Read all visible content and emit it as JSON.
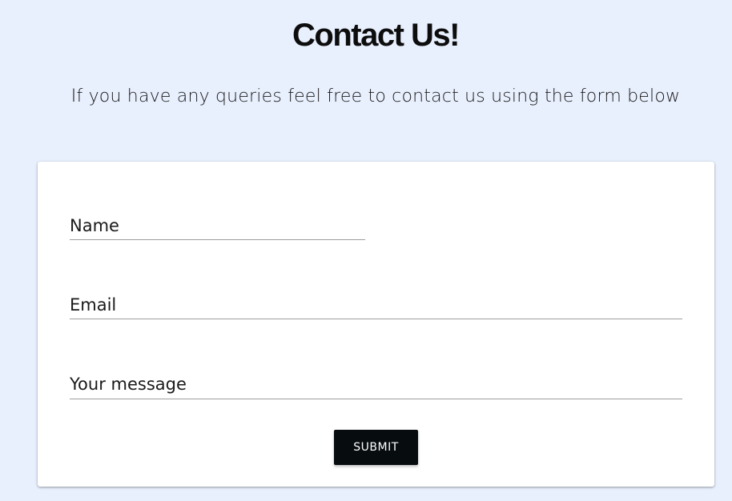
{
  "page": {
    "title": "Contact Us!",
    "subtitle": "If you have any queries feel free to contact us using the form below"
  },
  "form": {
    "name_placeholder": "Name",
    "email_placeholder": "Email",
    "message_placeholder": "Your message",
    "submit_label": "SUBMIT"
  },
  "colors": {
    "background": "#e8effd",
    "card": "#ffffff",
    "button": "#070c0f",
    "underline": "#9e9e9e"
  }
}
